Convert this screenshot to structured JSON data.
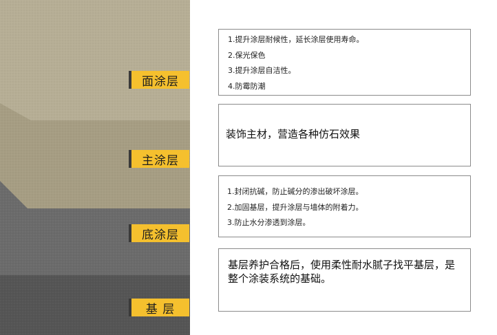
{
  "layers": [
    {
      "label": "面涂层",
      "description": null,
      "items": [
        "1.提升涂层耐候性，延长涂层使用寿命。",
        "2.保光保色",
        "3.提升涂层自洁性。",
        "4.防霉防潮"
      ]
    },
    {
      "label": "主涂层",
      "description": "装饰主材，营造各种仿石效果",
      "items": []
    },
    {
      "label": "底涂层",
      "description": null,
      "items": [
        "1.封闭抗碱，防止碱分的渗出破坏涂层。",
        "2.加固基层，提升涂层与墙体的附着力。",
        "3.防止水分渗透到涂层。"
      ]
    },
    {
      "label": "基 层",
      "description": "基层养护合格后，使用柔性耐水腻子找平基层，是整个涂装系统的基础。",
      "items": []
    }
  ],
  "colors": {
    "tag": "#f5c02e",
    "top_coat": "#b6ae95",
    "main_coat": "#a69d83",
    "primer": "#6b6b6b",
    "substrate": "#555555"
  }
}
